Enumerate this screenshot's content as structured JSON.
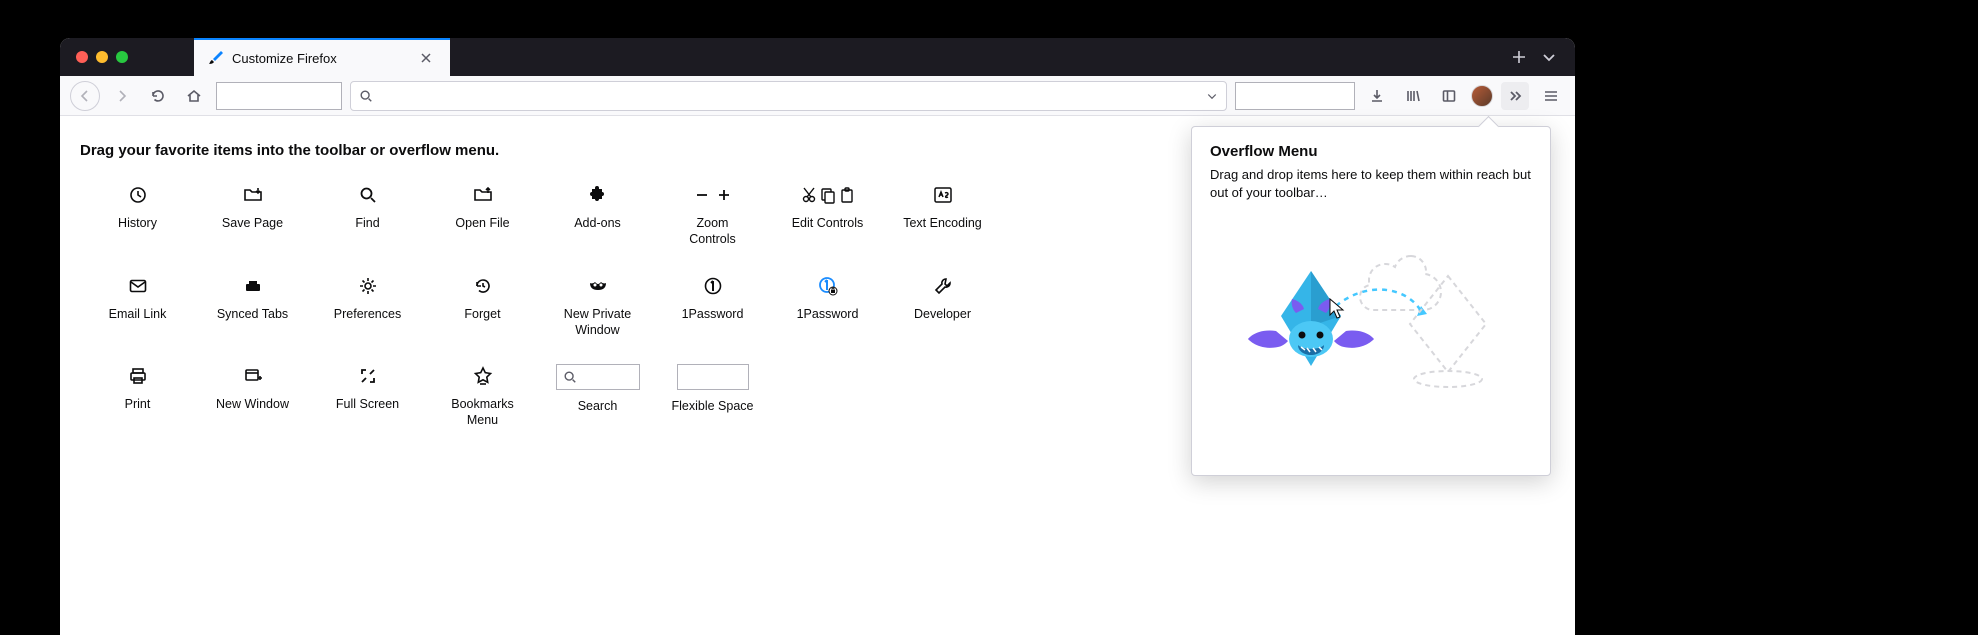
{
  "tab": {
    "title": "Customize Firefox"
  },
  "instructions": "Drag your favorite items into the toolbar or overflow menu.",
  "palette": [
    {
      "id": "history",
      "label": "History"
    },
    {
      "id": "save-page",
      "label": "Save Page"
    },
    {
      "id": "find",
      "label": "Find"
    },
    {
      "id": "open-file",
      "label": "Open File"
    },
    {
      "id": "addons",
      "label": "Add-ons"
    },
    {
      "id": "zoom-controls",
      "label": "Zoom\nControls"
    },
    {
      "id": "edit-controls",
      "label": "Edit Controls"
    },
    {
      "id": "text-encoding",
      "label": "Text Encoding"
    },
    {
      "id": "spacer1",
      "label": ""
    },
    {
      "id": "email-link",
      "label": "Email Link"
    },
    {
      "id": "synced-tabs",
      "label": "Synced Tabs"
    },
    {
      "id": "preferences",
      "label": "Preferences"
    },
    {
      "id": "forget",
      "label": "Forget"
    },
    {
      "id": "new-private",
      "label": "New Private\nWindow"
    },
    {
      "id": "1password-a",
      "label": "1Password"
    },
    {
      "id": "1password-b",
      "label": "1Password"
    },
    {
      "id": "developer",
      "label": "Developer"
    },
    {
      "id": "spacer2",
      "label": ""
    },
    {
      "id": "print",
      "label": "Print"
    },
    {
      "id": "new-window",
      "label": "New Window"
    },
    {
      "id": "full-screen",
      "label": "Full Screen"
    },
    {
      "id": "bookmarks-menu",
      "label": "Bookmarks\nMenu"
    },
    {
      "id": "search",
      "label": "Search"
    },
    {
      "id": "flexible-space",
      "label": "Flexible Space"
    }
  ],
  "overflow": {
    "title": "Overflow Menu",
    "desc": "Drag and drop items here to keep them within reach but out of your toolbar…"
  }
}
